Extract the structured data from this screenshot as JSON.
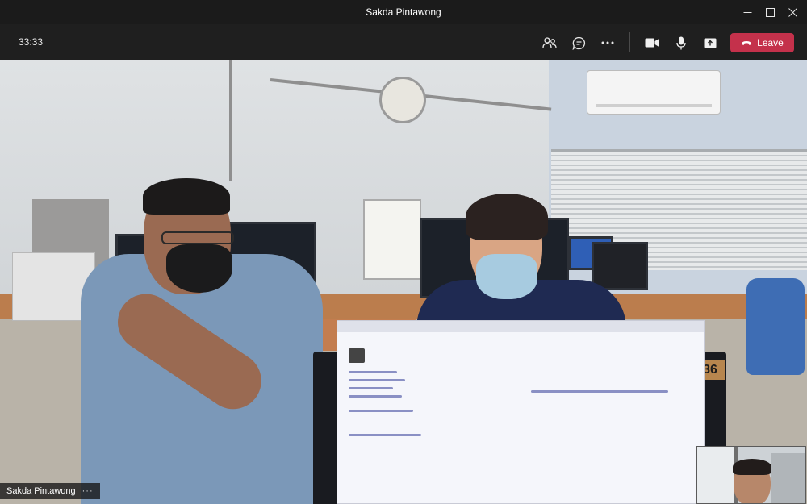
{
  "window": {
    "title": "Sakda Pintawong"
  },
  "toolbar": {
    "timer": "33:33",
    "leave_label": "Leave",
    "buttons": [
      "people-icon",
      "chat-icon",
      "more-icon",
      "camera-icon",
      "mic-icon",
      "share-icon"
    ]
  },
  "stage": {
    "participant_name": "Sakda Pintawong",
    "name_more": "···",
    "monitor_number": "36"
  },
  "colors": {
    "leave": "#c4314b",
    "titlebar": "#1b1b1b",
    "toolbar": "#1f1f1f"
  }
}
